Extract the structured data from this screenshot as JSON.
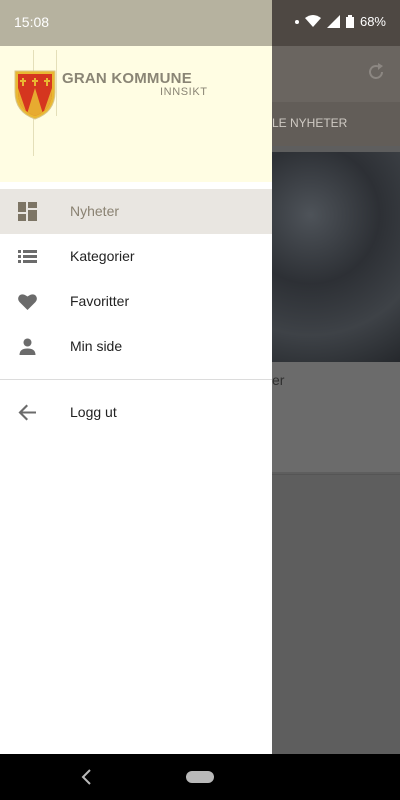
{
  "status_bar": {
    "time": "15:08",
    "battery": "68%"
  },
  "background_app": {
    "tab_label": "LE NYHETER",
    "card_text": "er"
  },
  "drawer": {
    "brand": {
      "title": "GRAN KOMMUNE",
      "subtitle": "INNSIKT"
    },
    "items": [
      {
        "label": "Nyheter",
        "icon": "dashboard-icon",
        "active": true
      },
      {
        "label": "Kategorier",
        "icon": "list-icon",
        "active": false
      },
      {
        "label": "Favoritter",
        "icon": "heart-icon",
        "active": false
      },
      {
        "label": "Min side",
        "icon": "person-icon",
        "active": false
      }
    ],
    "logout": {
      "label": "Logg ut",
      "icon": "arrow-back-icon"
    }
  },
  "colors": {
    "accent": "#8a8272",
    "header_bg": "#fffde3",
    "active_bg": "#e9e6e1"
  }
}
